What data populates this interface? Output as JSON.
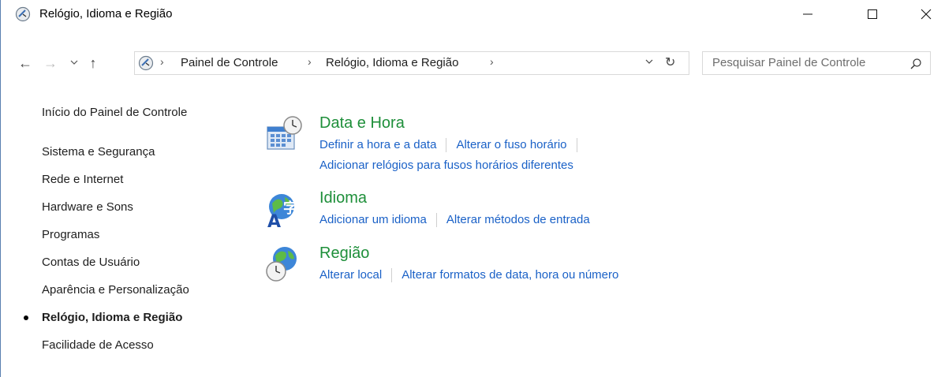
{
  "window": {
    "title": "Relógio, Idioma e Região",
    "controls": {
      "minimize": "─",
      "maximize": "☐",
      "close": "✕"
    }
  },
  "navigation": {
    "back": "←",
    "forward": "→",
    "recent": "⌄",
    "up": "↑",
    "breadcrumb": [
      "Painel de Controle",
      "Relógio, Idioma e Região"
    ],
    "separator": "›",
    "dropdown": "⌄",
    "refresh": "↻"
  },
  "search": {
    "placeholder": "Pesquisar Painel de Controle"
  },
  "sidebar": {
    "home": "Início do Painel de Controle",
    "items": [
      {
        "label": "Sistema e Segurança",
        "current": false
      },
      {
        "label": "Rede e Internet",
        "current": false
      },
      {
        "label": "Hardware e Sons",
        "current": false
      },
      {
        "label": "Programas",
        "current": false
      },
      {
        "label": "Contas de Usuário",
        "current": false
      },
      {
        "label": "Aparência e Personalização",
        "current": false
      },
      {
        "label": "Relógio, Idioma e Região",
        "current": true
      },
      {
        "label": "Facilidade de Acesso",
        "current": false
      }
    ]
  },
  "categories": [
    {
      "icon": "calendar-clock-icon",
      "title": "Data e Hora",
      "links": [
        "Definir a hora e a data",
        "Alterar o fuso horário",
        "Adicionar relógios para fusos horários diferentes"
      ]
    },
    {
      "icon": "language-globe-icon",
      "title": "Idioma",
      "links": [
        "Adicionar um idioma",
        "Alterar métodos de entrada"
      ]
    },
    {
      "icon": "region-globe-clock-icon",
      "title": "Região",
      "links": [
        "Alterar local",
        "Alterar formatos de data, hora ou número"
      ]
    }
  ],
  "colors": {
    "link": "#1a61c7",
    "category_title": "#1e8f3a",
    "window_border": "#5a7fb0"
  }
}
